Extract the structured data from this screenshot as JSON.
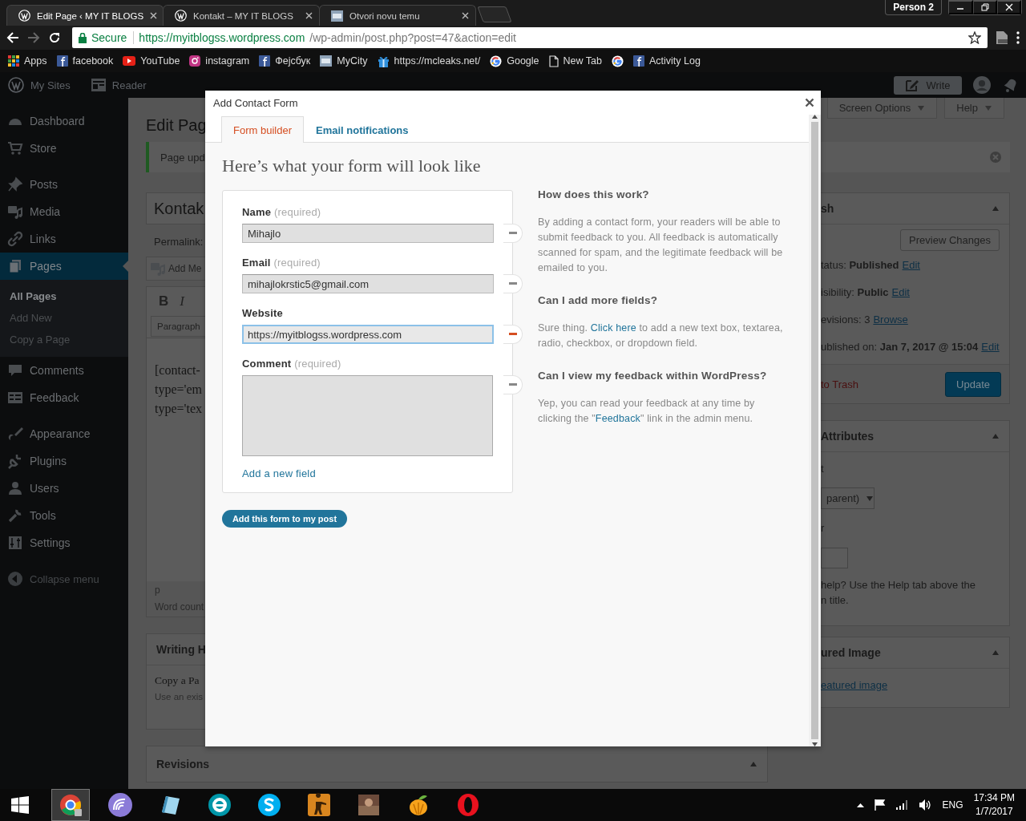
{
  "browser": {
    "tabs": [
      {
        "title": "Edit Page ‹ MY IT BLOGS",
        "kind": "wordpress",
        "selected": true
      },
      {
        "title": "Kontakt – MY IT BLOGS",
        "kind": "wordpress",
        "selected": false
      },
      {
        "title": "Otvori novu temu",
        "kind": "tile",
        "selected": false
      }
    ],
    "profile": "Person 2"
  },
  "address": {
    "secure": "Secure",
    "host": "https://myitblogss.wordpress.com",
    "path": "/wp-admin/post.php?post=47&action=edit"
  },
  "bookmarks": [
    {
      "label": "Apps",
      "kind": "apps"
    },
    {
      "label": "facebook",
      "kind": "facebook"
    },
    {
      "label": "YouTube",
      "kind": "youtube"
    },
    {
      "label": "instagram",
      "kind": "instagram"
    },
    {
      "label": "Фејсбук",
      "kind": "facebook"
    },
    {
      "label": "MyCity",
      "kind": "tile"
    },
    {
      "label": "https://mcleaks.net/",
      "kind": "gift"
    },
    {
      "label": "Google",
      "kind": "google"
    },
    {
      "label": "New Tab",
      "kind": "page"
    },
    {
      "kind": "google"
    },
    {
      "label": "Activity Log",
      "kind": "facebook"
    }
  ],
  "admin_bar": {
    "items": [
      {
        "label": "My Sites",
        "kind": "wordpress"
      },
      {
        "label": "Reader",
        "kind": "reader"
      }
    ],
    "write": "Write"
  },
  "sidebar": {
    "groups": [
      [
        {
          "label": "Dashboard",
          "kind": "dashboard",
          "selected": false
        },
        {
          "label": "Store",
          "kind": "cart",
          "selected": false
        }
      ],
      [
        {
          "label": "Posts",
          "kind": "pin",
          "selected": false
        },
        {
          "label": "Media",
          "kind": "media",
          "selected": false
        },
        {
          "label": "Links",
          "kind": "link",
          "selected": false
        },
        {
          "label": "Pages",
          "kind": "pages",
          "selected": true,
          "children": [
            {
              "label": "All Pages",
              "selected": true
            },
            {
              "label": "Add New",
              "selected": false
            },
            {
              "label": "Copy a Page",
              "selected": false
            }
          ]
        },
        {
          "label": "Comments",
          "kind": "comment",
          "selected": false
        },
        {
          "label": "Feedback",
          "kind": "feedback",
          "selected": false
        }
      ],
      [
        {
          "label": "Appearance",
          "kind": "brush",
          "selected": false
        },
        {
          "label": "Plugins",
          "kind": "plug",
          "selected": false
        },
        {
          "label": "Users",
          "kind": "user",
          "selected": false
        },
        {
          "label": "Tools",
          "kind": "wrench",
          "selected": false
        },
        {
          "label": "Settings",
          "kind": "sliders",
          "selected": false
        }
      ]
    ],
    "collapse": "Collapse menu"
  },
  "page": {
    "screen_options": "Screen Options",
    "help": "Help",
    "heading": "Edit Pag",
    "notice": "Page upd",
    "title": "Kontak",
    "permalink": "Permalink:",
    "add_media": "Add Me",
    "format_buttons": [
      "B",
      "I"
    ],
    "format": "Paragraph",
    "content": [
      "[contact-",
      "type='em",
      "type='tex"
    ],
    "path": "p",
    "word_count": "Word count",
    "writing_helper": {
      "title": "Writing H",
      "link": "Copy a Pa",
      "text": "Use an exis"
    },
    "revisions": "Revisions",
    "publish": {
      "title": "sh",
      "preview": "Preview Changes",
      "rows": [
        {
          "label": "tatus:",
          "value": "Published",
          "action": "Edit"
        },
        {
          "label": "isibility:",
          "value": "Public",
          "action": "Edit"
        },
        {
          "label": "evisions: 3",
          "action": "Browse"
        },
        {
          "label": "ublished on:",
          "value": "Jan 7, 2017 @ 15:04",
          "action": "Edit"
        }
      ],
      "trash": "to Trash",
      "update": "Update"
    },
    "attributes": {
      "title": "Attributes",
      "parent_label": "t",
      "parent_value": "parent)",
      "order_label": "r",
      "help": [
        "help? Use the Help tab above the",
        "n title."
      ]
    },
    "featured": {
      "title": "ured Image",
      "link": "eatured image"
    }
  },
  "dialog": {
    "title": "Add Contact Form",
    "tabs": [
      {
        "label": "Form builder",
        "selected": true
      },
      {
        "label": "Email notifications",
        "selected": false
      }
    ],
    "heading": "Here’s what your form will look like",
    "fields": [
      {
        "label": "Name",
        "note": "(required)",
        "value": "Mihajlo",
        "kind": "text",
        "focused": false
      },
      {
        "label": "Email",
        "note": "(required)",
        "value": "mihajlokrstic5@gmail.com",
        "kind": "text",
        "focused": false
      },
      {
        "label": "Website",
        "value": "https://myitblogss.wordpress.com",
        "kind": "text",
        "focused": true
      },
      {
        "label": "Comment",
        "note": "(required)",
        "kind": "textarea",
        "focused": false
      }
    ],
    "add_field": "Add a new field",
    "submit": "Add this form to my post",
    "help": [
      {
        "question": "How does this work?",
        "parts": [
          {
            "text": "By adding a contact form, your readers will be able to submit feedback to you. All feedback is automatically scanned for spam, and the legitimate feedback will be emailed to you.",
            "link": false
          }
        ]
      },
      {
        "question": "Can I add more fields?",
        "parts": [
          {
            "text": "Sure thing. ",
            "link": false
          },
          {
            "text": "Click here",
            "link": true
          },
          {
            "text": " to add a new text box, textarea, radio, checkbox, or dropdown field.",
            "link": false
          }
        ]
      },
      {
        "question": "Can I view my feedback within WordPress?",
        "parts": [
          {
            "text": "Yep, you can read your feedback at any time by clicking the \"",
            "link": false
          },
          {
            "text": "Feedback",
            "link": true
          },
          {
            "text": "\" link in the admin menu.",
            "link": false
          }
        ]
      }
    ]
  },
  "taskbar": {
    "apps": [
      {
        "kind": "chrome",
        "selected": true
      },
      {
        "kind": "torrent",
        "selected": false
      },
      {
        "kind": "notepad",
        "selected": false
      },
      {
        "kind": "eset",
        "selected": false
      },
      {
        "kind": "skype",
        "selected": false
      },
      {
        "kind": "soldier",
        "selected": false
      },
      {
        "kind": "game",
        "selected": false
      },
      {
        "kind": "fruit",
        "selected": false
      },
      {
        "kind": "opera",
        "selected": false
      }
    ],
    "language": "ENG",
    "time": "17:34 PM",
    "date": "1/7/2017"
  }
}
